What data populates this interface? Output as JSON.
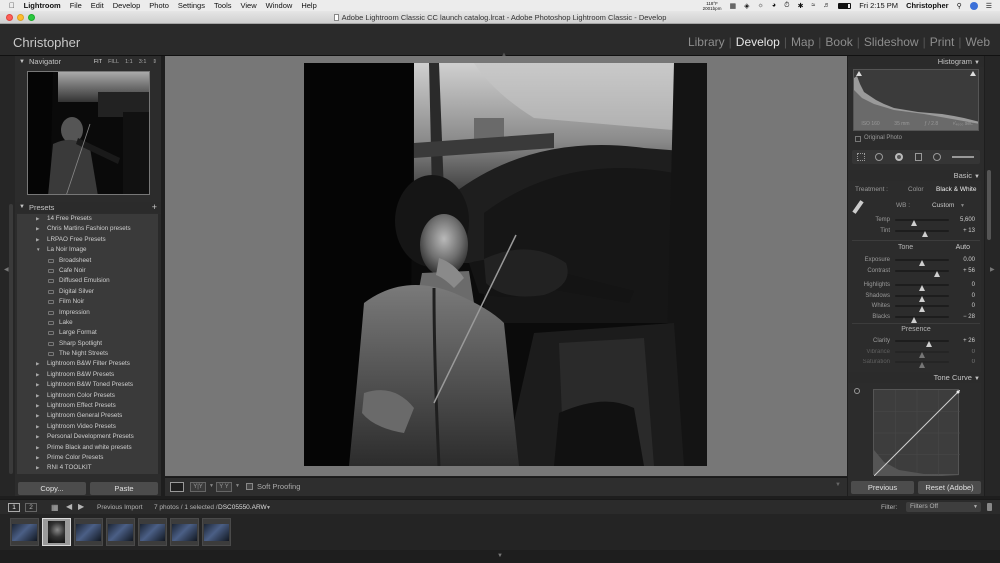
{
  "menubar": {
    "items": [
      "Lightroom",
      "File",
      "Edit",
      "Develop",
      "Photo",
      "Settings",
      "Tools",
      "View",
      "Window",
      "Help"
    ],
    "weather_temp": "118°F",
    "weather_sub": "2001bpm",
    "clock": "Fri 2:15 PM",
    "user": "Christopher"
  },
  "window_title": "Adobe Lightroom Classic CC launch catalog.lrcat - Adobe Photoshop Lightroom Classic - Develop",
  "identity_plate": "Christopher",
  "modules": [
    "Library",
    "Develop",
    "Map",
    "Book",
    "Slideshow",
    "Print",
    "Web"
  ],
  "active_module": "Develop",
  "navigator": {
    "title": "Navigator",
    "zoom_options": [
      "FIT",
      "FILL",
      "1:1",
      "3:1"
    ]
  },
  "presets": {
    "title": "Presets",
    "add_icon": "plus-icon",
    "items": [
      {
        "label": "14 Free Presets",
        "type": "folder"
      },
      {
        "label": "Chris Martins Fashion presets",
        "type": "folder"
      },
      {
        "label": "LRPAO Free Presets",
        "type": "folder"
      },
      {
        "label": "La Noir Image",
        "type": "folder-open"
      },
      {
        "label": "Broadsheet",
        "type": "child"
      },
      {
        "label": "Cafe Noir",
        "type": "child"
      },
      {
        "label": "Diffused Emulsion",
        "type": "child"
      },
      {
        "label": "Digital Silver",
        "type": "child"
      },
      {
        "label": "Film Noir",
        "type": "child"
      },
      {
        "label": "Impression",
        "type": "child"
      },
      {
        "label": "Lake",
        "type": "child"
      },
      {
        "label": "Large Format",
        "type": "child"
      },
      {
        "label": "Sharp Spotlight",
        "type": "child"
      },
      {
        "label": "The Night Streets",
        "type": "child"
      },
      {
        "label": "Lightroom B&W Filter Presets",
        "type": "folder"
      },
      {
        "label": "Lightroom B&W Presets",
        "type": "folder"
      },
      {
        "label": "Lightroom B&W Toned Presets",
        "type": "folder"
      },
      {
        "label": "Lightroom Color Presets",
        "type": "folder"
      },
      {
        "label": "Lightroom Effect Presets",
        "type": "folder"
      },
      {
        "label": "Lightroom General Presets",
        "type": "folder"
      },
      {
        "label": "Lightroom Video Presets",
        "type": "folder"
      },
      {
        "label": "Personal Development Presets",
        "type": "folder"
      },
      {
        "label": "Prime Black and white presets",
        "type": "folder"
      },
      {
        "label": "Prime Color Presets",
        "type": "folder"
      },
      {
        "label": "RNI 4 TOOLKIT",
        "type": "folder"
      }
    ]
  },
  "left_buttons": {
    "copy": "Copy...",
    "paste": "Paste"
  },
  "toolbar": {
    "soft_proofing": "Soft Proofing"
  },
  "histogram": {
    "title": "Histogram",
    "iso": "ISO 160",
    "focal": "35 mm",
    "aperture": "ƒ / 2.8",
    "shutter": "¹⁄₄₀₀₀ sec",
    "original_photo": "Original Photo"
  },
  "basic": {
    "title": "Basic",
    "treatment_label": "Treatment :",
    "treatment_color": "Color",
    "treatment_bw": "Black & White",
    "wb_label": "WB :",
    "wb_value": "Custom",
    "temp": {
      "label": "Temp",
      "value": "5,600",
      "pos": 0.35
    },
    "tint": {
      "label": "Tint",
      "value": "+ 13",
      "pos": 0.56
    },
    "tone_label": "Tone",
    "auto_label": "Auto",
    "exposure": {
      "label": "Exposure",
      "value": "0.00",
      "pos": 0.5
    },
    "contrast": {
      "label": "Contrast",
      "value": "+ 56",
      "pos": 0.78
    },
    "highlights": {
      "label": "Highlights",
      "value": "0",
      "pos": 0.5
    },
    "shadows": {
      "label": "Shadows",
      "value": "0",
      "pos": 0.5
    },
    "whites": {
      "label": "Whites",
      "value": "0",
      "pos": 0.5
    },
    "blacks": {
      "label": "Blacks",
      "value": "− 28",
      "pos": 0.36
    },
    "presence_label": "Presence",
    "clarity": {
      "label": "Clarity",
      "value": "+ 26",
      "pos": 0.63
    },
    "vibrance": {
      "label": "Vibrance",
      "value": "0",
      "pos": 0.5
    },
    "saturation": {
      "label": "Saturation",
      "value": "0",
      "pos": 0.5
    }
  },
  "tone_curve": {
    "title": "Tone Curve"
  },
  "right_buttons": {
    "previous": "Previous",
    "reset": "Reset (Adobe)"
  },
  "filmstrip": {
    "source": "Previous Import",
    "count": "7 photos / 1 selected /",
    "filename": "DSC05550.ARW",
    "filter_label": "Filter:",
    "filter_value": "Filters Off",
    "pages": [
      "1",
      "2"
    ]
  }
}
